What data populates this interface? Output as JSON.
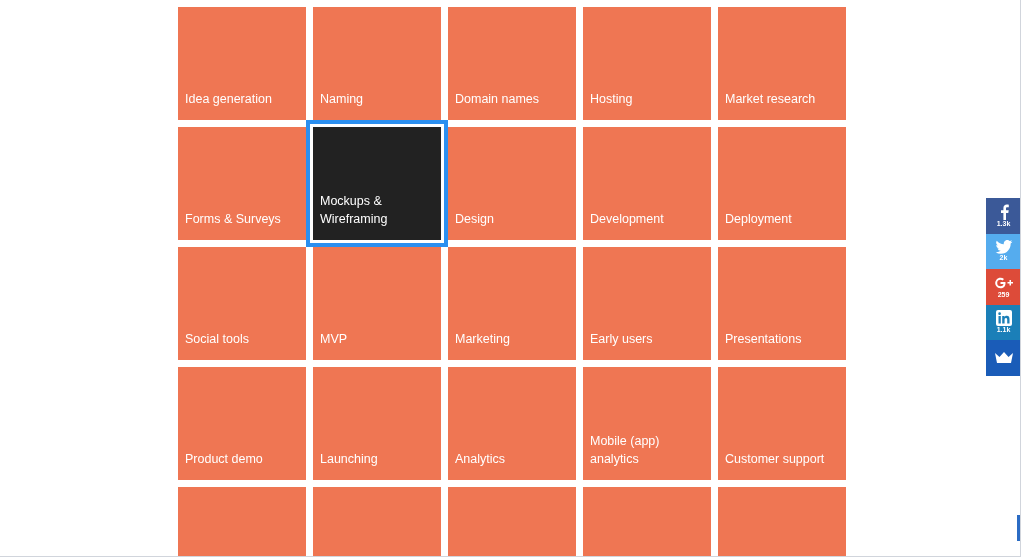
{
  "tile_rows": [
    [
      {
        "label": "Idea generation",
        "selected": false
      },
      {
        "label": "Naming",
        "selected": false
      },
      {
        "label": "Domain names",
        "selected": false
      },
      {
        "label": "Hosting",
        "selected": false
      },
      {
        "label": "Market research",
        "selected": false
      }
    ],
    [
      {
        "label": "Forms & Surveys",
        "selected": false
      },
      {
        "label": "Mockups & Wireframing",
        "selected": true
      },
      {
        "label": "Design",
        "selected": false
      },
      {
        "label": "Development",
        "selected": false
      },
      {
        "label": "Deployment",
        "selected": false
      }
    ],
    [
      {
        "label": "Social tools",
        "selected": false
      },
      {
        "label": "MVP",
        "selected": false
      },
      {
        "label": "Marketing",
        "selected": false
      },
      {
        "label": "Early users",
        "selected": false
      },
      {
        "label": "Presentations",
        "selected": false
      }
    ],
    [
      {
        "label": "Product demo",
        "selected": false
      },
      {
        "label": "Launching",
        "selected": false
      },
      {
        "label": "Analytics",
        "selected": false
      },
      {
        "label": "Mobile (app) analytics",
        "selected": false
      },
      {
        "label": "Customer support",
        "selected": false
      }
    ],
    [
      {
        "selected": false
      },
      {
        "selected": false
      },
      {
        "selected": false
      },
      {
        "selected": false
      },
      {
        "selected": false
      }
    ]
  ],
  "share_bar": [
    {
      "kind": "facebook",
      "count": "1.3k"
    },
    {
      "kind": "twitter",
      "count": "2k"
    },
    {
      "kind": "googleplus",
      "count": "259"
    },
    {
      "kind": "linkedin",
      "count": "1.1k"
    },
    {
      "kind": "crown"
    }
  ]
}
